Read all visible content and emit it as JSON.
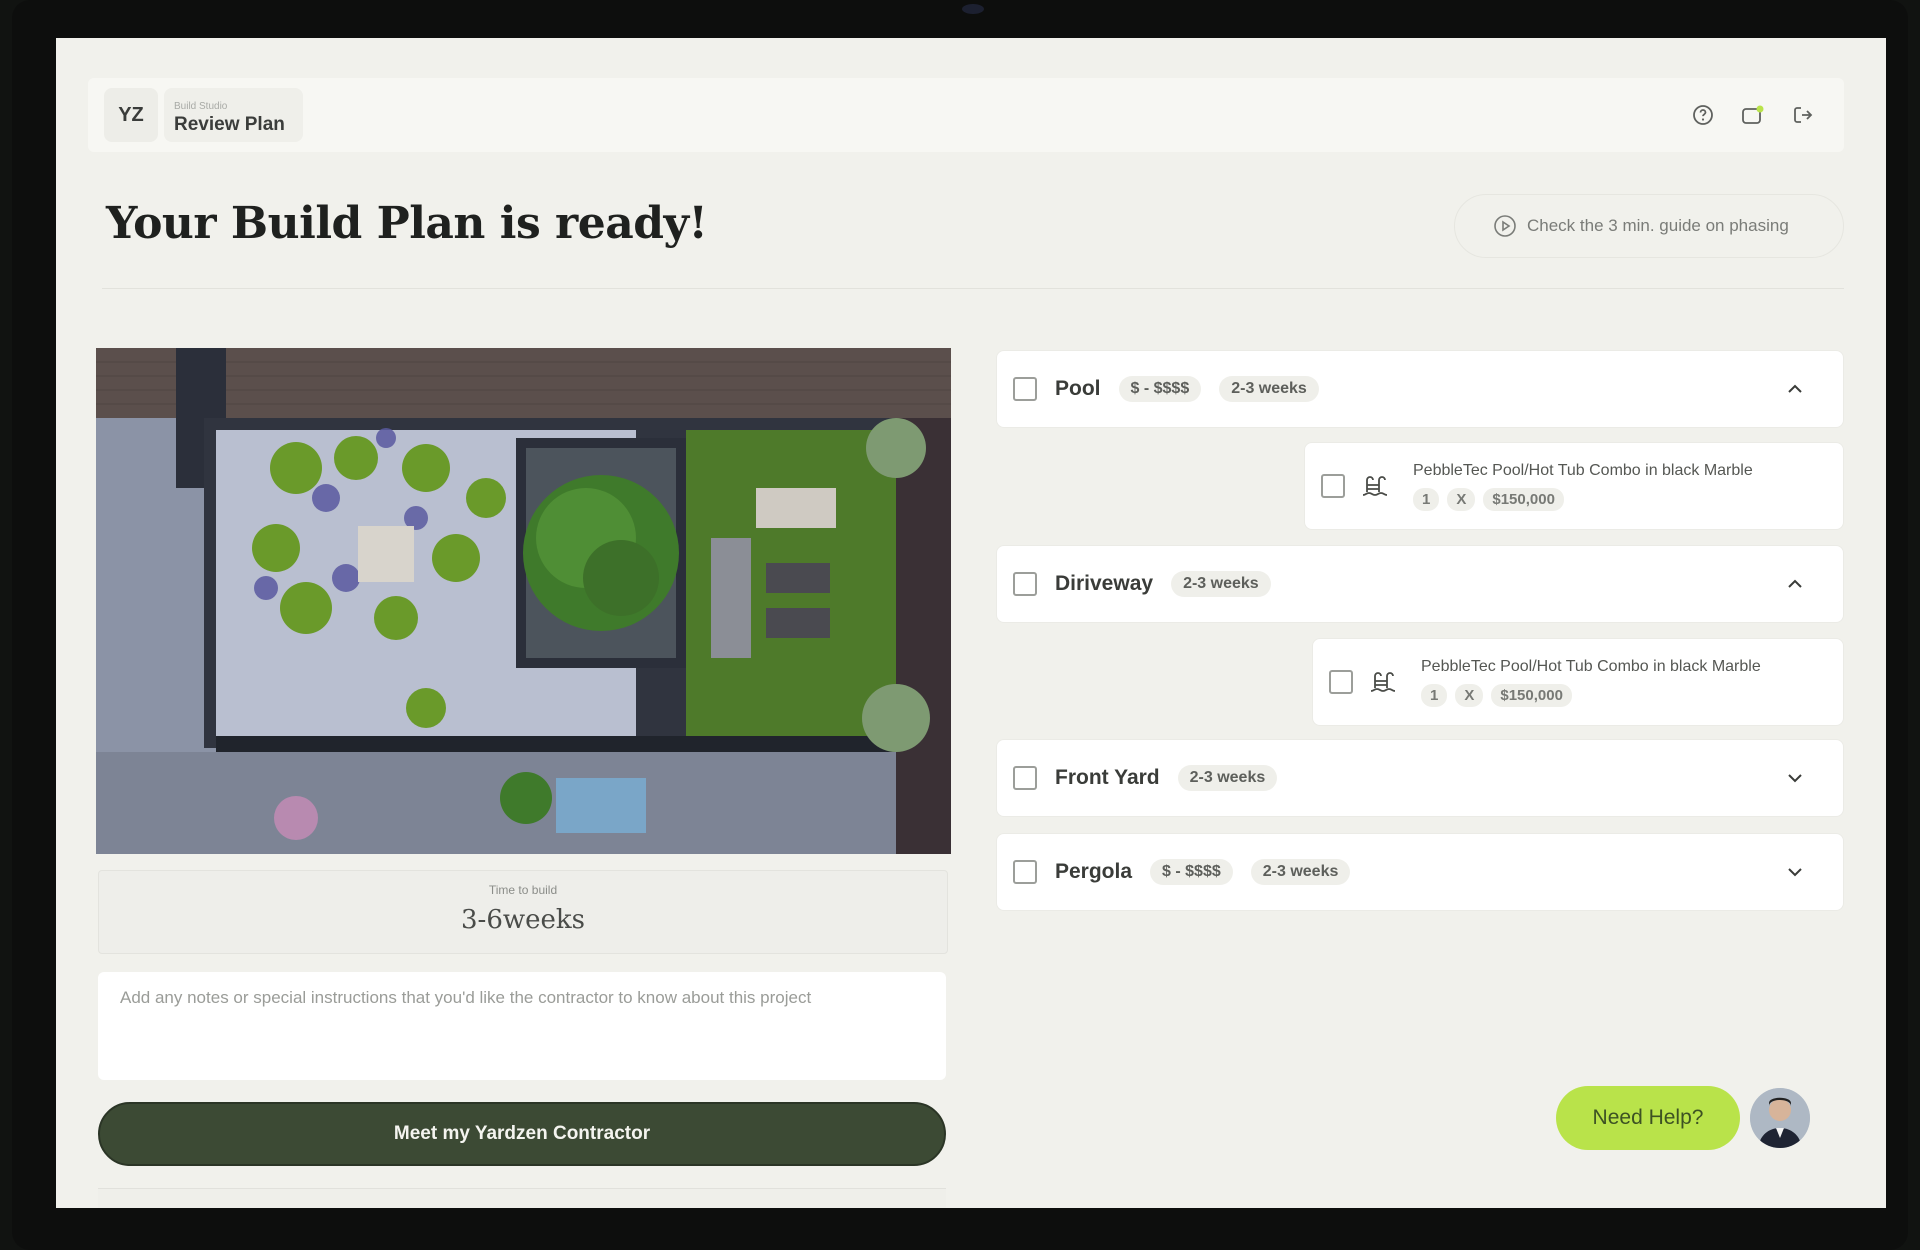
{
  "header": {
    "initials": "YZ",
    "breadcrumb_sub": "Build Studio",
    "breadcrumb_title": "Review Plan",
    "icons": [
      "help-circle-icon",
      "notification-icon",
      "logout-icon"
    ]
  },
  "page": {
    "title": "Your Build Plan is ready!",
    "guide_label": "Check the 3 min. guide on phasing"
  },
  "left": {
    "time_label": "Time to build",
    "time_value": "3-6weeks",
    "notes_placeholder": "Add any notes or special instructions that you'd like the contractor to know about this project",
    "cta_label": "Meet my Yardzen Contractor"
  },
  "phases": [
    {
      "name": "Pool",
      "price": "$ - $$$$",
      "duration": "2-3 weeks",
      "expanded": true,
      "item": {
        "title": "PebbleTec Pool/Hot Tub Combo in black Marble",
        "qty": "1",
        "x": "X",
        "price": "$150,000"
      }
    },
    {
      "name": "Diriveway",
      "price": "",
      "duration": "2-3 weeks",
      "expanded": true,
      "item": {
        "title": "PebbleTec Pool/Hot Tub Combo in black Marble",
        "qty": "1",
        "x": "X",
        "price": "$150,000"
      }
    },
    {
      "name": "Front Yard",
      "price": "",
      "duration": "2-3 weeks",
      "expanded": false
    },
    {
      "name": "Pergola",
      "price": "$ - $$$$",
      "duration": "2-3 weeks",
      "expanded": false
    }
  ],
  "help": {
    "label": "Need Help?"
  },
  "colors": {
    "cta": "#3c4a34",
    "help": "#b9e34a",
    "background": "#f1f1ec"
  }
}
